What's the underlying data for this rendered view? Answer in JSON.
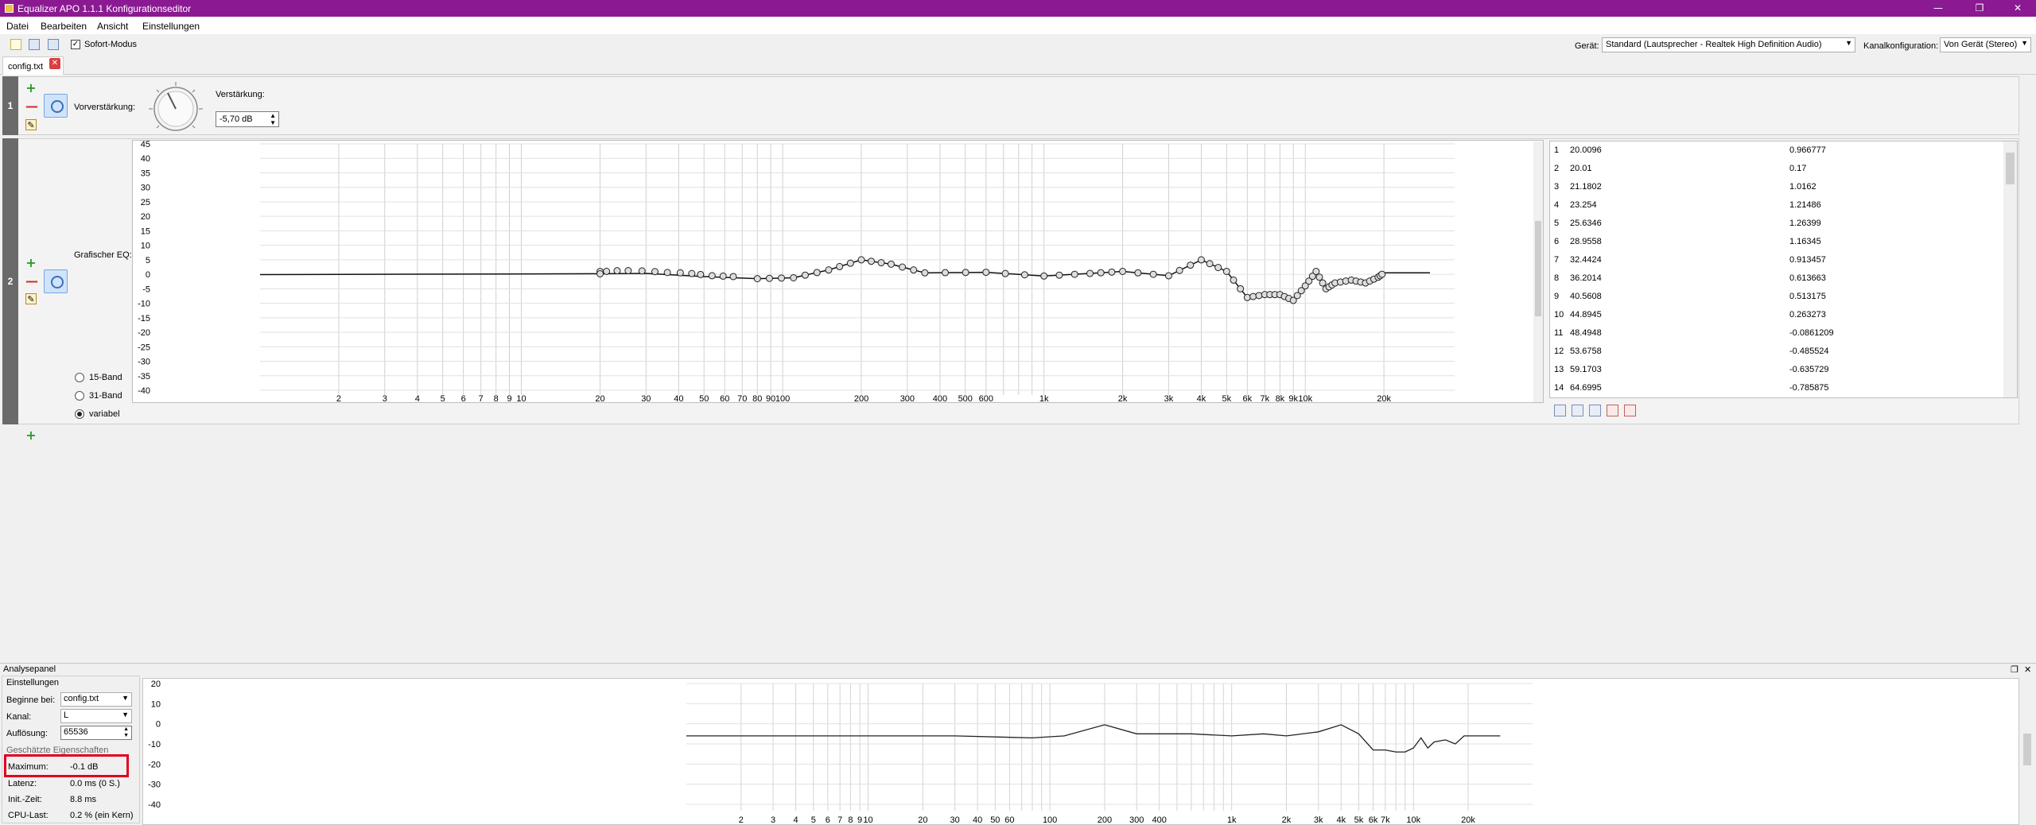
{
  "window": {
    "title": "Equalizer APO 1.1.1 Konfigurationseditor",
    "accent": "#8b1a92"
  },
  "menu": [
    "Datei",
    "Bearbeiten",
    "Ansicht",
    "Einstellungen"
  ],
  "toolbar": {
    "icons": [
      "new-file-icon",
      "save-icon",
      "save-all-icon"
    ],
    "instant_mode_label": "Sofort-Modus",
    "instant_mode_checked": true,
    "device_label": "Gerät:",
    "device_value": "Standard (Lautsprecher - Realtek High Definition Audio)",
    "channel_config_label": "Kanalkonfiguration:",
    "channel_config_value": "Von Gerät (Stereo)"
  },
  "tab": {
    "label": "config.txt"
  },
  "filter1": {
    "index": "1",
    "preamp_label": "Vorverstärkung:",
    "gain_label": "Verstärkung:",
    "gain_value": "-5,70 dB"
  },
  "filter2": {
    "index": "2",
    "eq_label": "Grafischer EQ:",
    "modes": [
      "15-Band",
      "31-Band",
      "variabel"
    ],
    "selected_mode": "variabel",
    "y_ticks": [
      "45",
      "40",
      "35",
      "30",
      "25",
      "20",
      "15",
      "10",
      "5",
      "0",
      "-5",
      "-10",
      "-15",
      "-20",
      "-25",
      "-30",
      "-35",
      "-40"
    ],
    "x_ticks": [
      "2",
      "3",
      "4",
      "5",
      "6",
      "7",
      "8",
      "9",
      "10",
      "20",
      "30",
      "40",
      "50",
      "60",
      "70",
      "80",
      "90",
      "100",
      "200",
      "300",
      "400",
      "500",
      "600",
      "1k",
      "2k",
      "3k",
      "4k",
      "5k",
      "6k",
      "7k",
      "8k",
      "9k",
      "10k",
      "20k"
    ],
    "table": [
      {
        "i": "1",
        "freq": "20.0096",
        "gain": "0.966777"
      },
      {
        "i": "2",
        "freq": "20.01",
        "gain": "0.17"
      },
      {
        "i": "3",
        "freq": "21.1802",
        "gain": "1.0162"
      },
      {
        "i": "4",
        "freq": "23.254",
        "gain": "1.21486"
      },
      {
        "i": "5",
        "freq": "25.6346",
        "gain": "1.26399"
      },
      {
        "i": "6",
        "freq": "28.9558",
        "gain": "1.16345"
      },
      {
        "i": "7",
        "freq": "32.4424",
        "gain": "0.913457"
      },
      {
        "i": "8",
        "freq": "36.2014",
        "gain": "0.613663"
      },
      {
        "i": "9",
        "freq": "40.5608",
        "gain": "0.513175"
      },
      {
        "i": "10",
        "freq": "44.8945",
        "gain": "0.263273"
      },
      {
        "i": "11",
        "freq": "48.4948",
        "gain": "-0.0861209"
      },
      {
        "i": "12",
        "freq": "53.6758",
        "gain": "-0.485524"
      },
      {
        "i": "13",
        "freq": "59.1703",
        "gain": "-0.635729"
      },
      {
        "i": "14",
        "freq": "64.6995",
        "gain": "-0.785875"
      }
    ]
  },
  "analysis": {
    "title": "Analysepanel",
    "settings_label": "Einstellungen",
    "start_label": "Beginne bei:",
    "start_value": "config.txt",
    "channel_label": "Kanal:",
    "channel_value": "L",
    "resolution_label": "Auflösung:",
    "resolution_value": "65536",
    "props_label": "Geschätzte Eigenschaften",
    "maximum_label": "Maximum:",
    "maximum_value": "-0.1 dB",
    "latency_label": "Latenz:",
    "latency_value": "0.0 ms (0 S.)",
    "init_label": "Init.-Zeit:",
    "init_value": "8.8 ms",
    "cpu_label": "CPU-Last:",
    "cpu_value": "0.2 % (ein Kern)",
    "y_ticks": [
      "20",
      "10",
      "0",
      "-10",
      "-20",
      "-30",
      "-40"
    ],
    "x_ticks": [
      "2",
      "3",
      "4",
      "5",
      "6",
      "7",
      "8",
      "9",
      "10",
      "20",
      "30",
      "40",
      "50",
      "60",
      "100",
      "200",
      "300",
      "400",
      "1k",
      "2k",
      "3k",
      "4k",
      "5k",
      "6k",
      "7k",
      "10k",
      "20k"
    ]
  }
}
